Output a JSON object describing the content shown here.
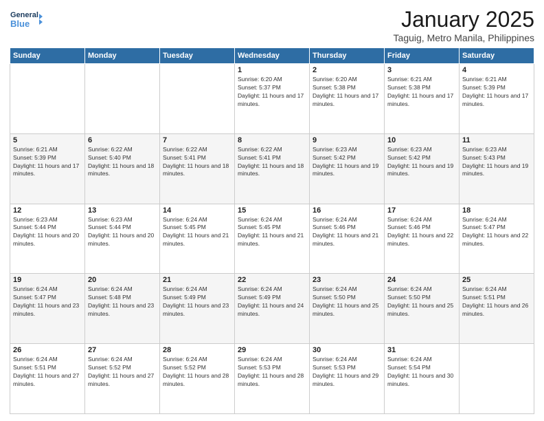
{
  "logo": {
    "line1": "General",
    "line2": "Blue"
  },
  "header": {
    "title": "January 2025",
    "subtitle": "Taguig, Metro Manila, Philippines"
  },
  "days": [
    "Sunday",
    "Monday",
    "Tuesday",
    "Wednesday",
    "Thursday",
    "Friday",
    "Saturday"
  ],
  "weeks": [
    [
      {
        "day": "",
        "content": ""
      },
      {
        "day": "",
        "content": ""
      },
      {
        "day": "",
        "content": ""
      },
      {
        "day": "1",
        "content": "Sunrise: 6:20 AM\nSunset: 5:37 PM\nDaylight: 11 hours and 17 minutes."
      },
      {
        "day": "2",
        "content": "Sunrise: 6:20 AM\nSunset: 5:38 PM\nDaylight: 11 hours and 17 minutes."
      },
      {
        "day": "3",
        "content": "Sunrise: 6:21 AM\nSunset: 5:38 PM\nDaylight: 11 hours and 17 minutes."
      },
      {
        "day": "4",
        "content": "Sunrise: 6:21 AM\nSunset: 5:39 PM\nDaylight: 11 hours and 17 minutes."
      }
    ],
    [
      {
        "day": "5",
        "content": "Sunrise: 6:21 AM\nSunset: 5:39 PM\nDaylight: 11 hours and 17 minutes."
      },
      {
        "day": "6",
        "content": "Sunrise: 6:22 AM\nSunset: 5:40 PM\nDaylight: 11 hours and 18 minutes."
      },
      {
        "day": "7",
        "content": "Sunrise: 6:22 AM\nSunset: 5:41 PM\nDaylight: 11 hours and 18 minutes."
      },
      {
        "day": "8",
        "content": "Sunrise: 6:22 AM\nSunset: 5:41 PM\nDaylight: 11 hours and 18 minutes."
      },
      {
        "day": "9",
        "content": "Sunrise: 6:23 AM\nSunset: 5:42 PM\nDaylight: 11 hours and 19 minutes."
      },
      {
        "day": "10",
        "content": "Sunrise: 6:23 AM\nSunset: 5:42 PM\nDaylight: 11 hours and 19 minutes."
      },
      {
        "day": "11",
        "content": "Sunrise: 6:23 AM\nSunset: 5:43 PM\nDaylight: 11 hours and 19 minutes."
      }
    ],
    [
      {
        "day": "12",
        "content": "Sunrise: 6:23 AM\nSunset: 5:44 PM\nDaylight: 11 hours and 20 minutes."
      },
      {
        "day": "13",
        "content": "Sunrise: 6:23 AM\nSunset: 5:44 PM\nDaylight: 11 hours and 20 minutes."
      },
      {
        "day": "14",
        "content": "Sunrise: 6:24 AM\nSunset: 5:45 PM\nDaylight: 11 hours and 21 minutes."
      },
      {
        "day": "15",
        "content": "Sunrise: 6:24 AM\nSunset: 5:45 PM\nDaylight: 11 hours and 21 minutes."
      },
      {
        "day": "16",
        "content": "Sunrise: 6:24 AM\nSunset: 5:46 PM\nDaylight: 11 hours and 21 minutes."
      },
      {
        "day": "17",
        "content": "Sunrise: 6:24 AM\nSunset: 5:46 PM\nDaylight: 11 hours and 22 minutes."
      },
      {
        "day": "18",
        "content": "Sunrise: 6:24 AM\nSunset: 5:47 PM\nDaylight: 11 hours and 22 minutes."
      }
    ],
    [
      {
        "day": "19",
        "content": "Sunrise: 6:24 AM\nSunset: 5:47 PM\nDaylight: 11 hours and 23 minutes."
      },
      {
        "day": "20",
        "content": "Sunrise: 6:24 AM\nSunset: 5:48 PM\nDaylight: 11 hours and 23 minutes."
      },
      {
        "day": "21",
        "content": "Sunrise: 6:24 AM\nSunset: 5:49 PM\nDaylight: 11 hours and 23 minutes."
      },
      {
        "day": "22",
        "content": "Sunrise: 6:24 AM\nSunset: 5:49 PM\nDaylight: 11 hours and 24 minutes."
      },
      {
        "day": "23",
        "content": "Sunrise: 6:24 AM\nSunset: 5:50 PM\nDaylight: 11 hours and 25 minutes."
      },
      {
        "day": "24",
        "content": "Sunrise: 6:24 AM\nSunset: 5:50 PM\nDaylight: 11 hours and 25 minutes."
      },
      {
        "day": "25",
        "content": "Sunrise: 6:24 AM\nSunset: 5:51 PM\nDaylight: 11 hours and 26 minutes."
      }
    ],
    [
      {
        "day": "26",
        "content": "Sunrise: 6:24 AM\nSunset: 5:51 PM\nDaylight: 11 hours and 27 minutes."
      },
      {
        "day": "27",
        "content": "Sunrise: 6:24 AM\nSunset: 5:52 PM\nDaylight: 11 hours and 27 minutes."
      },
      {
        "day": "28",
        "content": "Sunrise: 6:24 AM\nSunset: 5:52 PM\nDaylight: 11 hours and 28 minutes."
      },
      {
        "day": "29",
        "content": "Sunrise: 6:24 AM\nSunset: 5:53 PM\nDaylight: 11 hours and 28 minutes."
      },
      {
        "day": "30",
        "content": "Sunrise: 6:24 AM\nSunset: 5:53 PM\nDaylight: 11 hours and 29 minutes."
      },
      {
        "day": "31",
        "content": "Sunrise: 6:24 AM\nSunset: 5:54 PM\nDaylight: 11 hours and 30 minutes."
      },
      {
        "day": "",
        "content": ""
      }
    ]
  ]
}
